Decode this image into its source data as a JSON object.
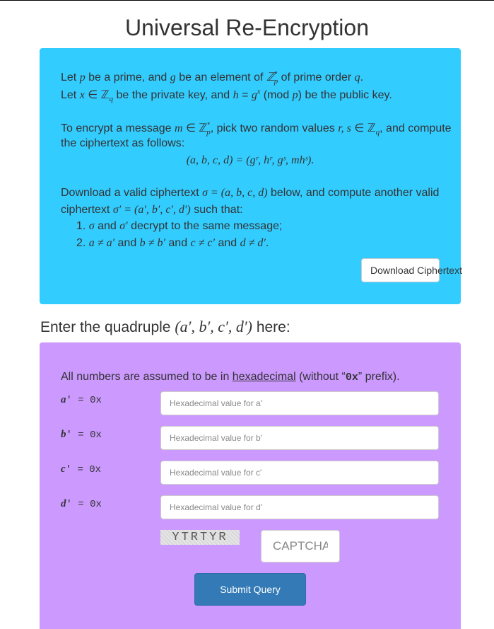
{
  "page": {
    "title": "Universal Re-Encryption"
  },
  "intro": {
    "l1a": "Let ",
    "l1_p": "p",
    "l1b": " be a prime, and ",
    "l1_g": "g",
    "l1c": " be an element of ",
    "l1_Z": "ℤ",
    "l1_Zsub": "p",
    "l1_Zsup": "*",
    "l1d": " of prime order ",
    "l1_q": "q",
    "l1e": ".",
    "l2a": "Let ",
    "l2_x": "x",
    "l2_in": " ∈ ℤ",
    "l2_sub": "q",
    "l2b": " be the private key, and ",
    "l2_h": "h",
    "l2c": " = ",
    "l2_g": "g",
    "l2_sup": "x",
    "l2d": " (mod ",
    "l2_p": "p",
    "l2e": ") be the public key.",
    "l3a": "To encrypt a message ",
    "l3_m": "m",
    "l3_in": " ∈ ℤ",
    "l3_sub": "p",
    "l3_sup": "*",
    "l3b": ", pick two random values ",
    "l3_rs": "r, s",
    "l3_in2": " ∈ ℤ",
    "l3_sub2": "q",
    "l3c": ", and compute",
    "l4": "the ciphertext as follows:",
    "formula": "(a, b, c, d) = (gʳ, hʳ, gˢ, mhˢ).",
    "l5a": "Download a valid ciphertext ",
    "l5_sigma": "σ = (a, b, c, d)",
    "l5b": " below, and compute another valid",
    "l6a": "ciphertext ",
    "l6_sigma": "σ′ = (a′, b′, c′, d′)",
    "l6b": " such that:",
    "item1a": "1. ",
    "item1_m1": "σ",
    "item1b": " and ",
    "item1_m2": "σ′",
    "item1c": " decrypt to the same message;",
    "item2a": "2. ",
    "item2_m1": "a ≠ a′",
    "item2b": " and ",
    "item2_m2": "b ≠ b′",
    "item2c": " and ",
    "item2_m3": "c ≠ c′",
    "item2d": " and ",
    "item2_m4": "d ≠ d′",
    "item2e": ".",
    "download_label": "Download Ciphertext"
  },
  "form": {
    "heading_a": "Enter the quadruple ",
    "heading_math": "(a′, b′, c′, d′)",
    "heading_b": " here:",
    "note_a": "All numbers are assumed to be in ",
    "note_link": "hexadecimal",
    "note_b": " (without “",
    "note_code": "0x",
    "note_c": "” prefix).",
    "fields": [
      {
        "var": "a",
        "rest": "' = 0x",
        "placeholder": "Hexadecimal value for a'"
      },
      {
        "var": "b",
        "rest": "' = 0x",
        "placeholder": "Hexadecimal value for b'"
      },
      {
        "var": "c",
        "rest": "' = 0x",
        "placeholder": "Hexadecimal value for c'"
      },
      {
        "var": "d",
        "rest": "' = 0x",
        "placeholder": "Hexadecimal value for d'"
      }
    ],
    "captcha_text": "YTRTYR",
    "captcha_placeholder": "CAPTCHA",
    "submit_label": "Submit Query"
  },
  "colors": {
    "blue_panel": "#33ccff",
    "purple_panel": "#cc99ff",
    "submit": "#337ab7"
  }
}
